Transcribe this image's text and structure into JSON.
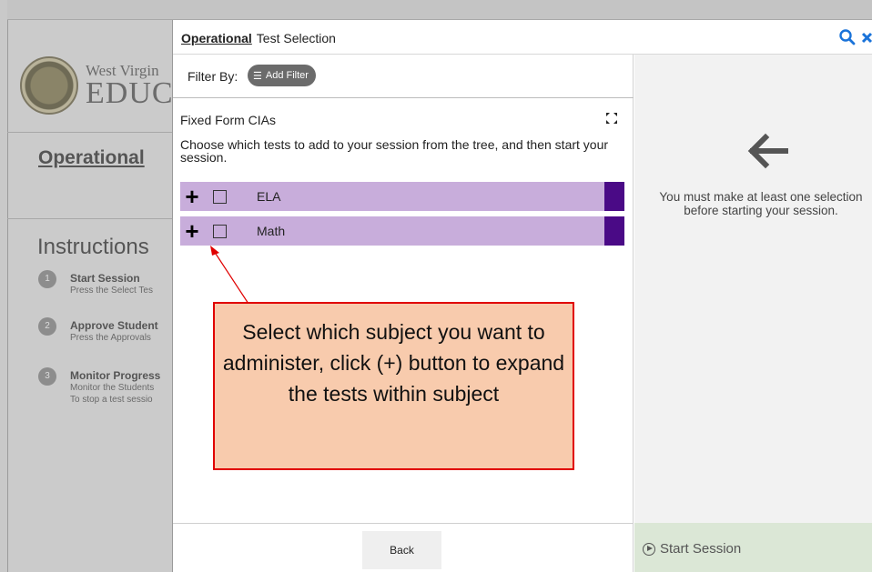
{
  "background": {
    "brand_line1": "West Virgin",
    "brand_line2": "EDUC",
    "page_title": "Operational",
    "instructions_heading": "Instructions",
    "steps": [
      {
        "num": "1",
        "title": "Start Session",
        "line1": "Press the Select Tes",
        "line2": ""
      },
      {
        "num": "2",
        "title": "Approve Student",
        "line1": "Press the Approvals",
        "line2": ""
      },
      {
        "num": "3",
        "title": "Monitor Progress",
        "line1": "Monitor the Students",
        "line2": "To stop a test sessio"
      }
    ]
  },
  "modal": {
    "title_strong": "Operational",
    "title_rest": "Test Selection",
    "filter_label": "Filter By:",
    "add_filter_label": "Add Filter",
    "form_title": "Fixed Form CIAs",
    "form_description": "Choose which tests to add to your session from the tree, and then start your session.",
    "subjects": [
      {
        "label": "ELA"
      },
      {
        "label": "Math"
      }
    ],
    "back_label": "Back",
    "right_message": "You must make at least one selection before starting your session.",
    "start_session_label": "Start Session"
  },
  "annotation": {
    "text": "Select which subject you want to administer, click (+) button to expand the tests within subject"
  },
  "colors": {
    "subject_row": "#c8addb",
    "subject_endcap": "#4a0a86",
    "callout_fill": "#f8cbad",
    "callout_border": "#e00000",
    "start_bar": "#dbe7d6",
    "header_icons": "#1a73d9"
  }
}
